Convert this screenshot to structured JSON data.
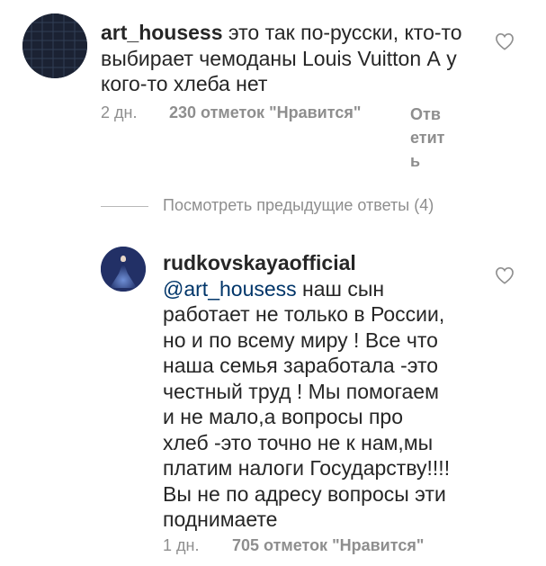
{
  "comments": [
    {
      "username": "art_housess",
      "text": "это так по-русски, кто-то выбирает чемоданы Louis Vuitton А у кого-то хлеба нет",
      "lines": [
        "это так по-русски, кто-то",
        "выбирает чемоданы Louis Vuitton А у",
        "кого-то хлеба нет"
      ],
      "time": "2 дн.",
      "likes": "230 отметок \"Нравится\"",
      "reply_label": "Ответить",
      "reply_lines": [
        "Отв",
        "етит",
        "ь"
      ],
      "avatar_icon": "dark-pattern-avatar"
    },
    {
      "username": "rudkovskayaofficial",
      "mention": "@art_housess",
      "text": "наш сын работает не только в России, но и по всему миру ! Все что наша семья заработала -это честный труд ! Мы помогаем и не мало,а вопросы про хлеб -это точно не к нам,мы платим налоги Государству!!!! Вы не по адресу вопросы эти поднимаете",
      "lines": [
        "наш сын",
        "работает не только в России,",
        "но и по всему миру ! Все что",
        "наша семья заработала -это",
        "честный труд ! Мы помогаем",
        "и не мало,а вопросы про",
        "хлеб -это точно не к нам,мы",
        "платим налоги Государству!!!!",
        "Вы не по адресу вопросы эти",
        "поднимаете"
      ],
      "time": "1 дн.",
      "likes": "705 отметок \"Нравится\"",
      "avatar_icon": "blue-gown-avatar"
    }
  ],
  "view_replies": "Посмотреть предыдущие ответы (4)",
  "icons": {
    "like": "heart-outline-icon"
  },
  "colors": {
    "text": "#262626",
    "secondary": "#8e8e8e",
    "mention": "#003569",
    "background": "#ffffff"
  }
}
